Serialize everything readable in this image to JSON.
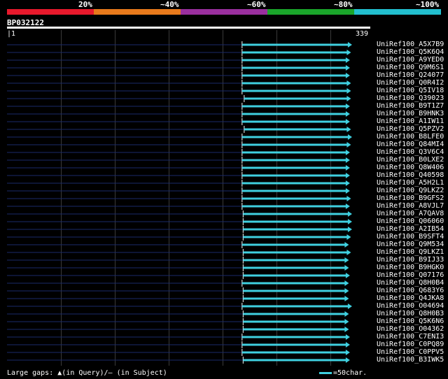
{
  "identity_scale": {
    "labels": [
      "20%",
      "~40%",
      "~60%",
      "~80%",
      "~100%"
    ],
    "colors": [
      "#e8192c",
      "#e87a1c",
      "#9a2f9e",
      "#1aa52a",
      "#22bfcf"
    ]
  },
  "query": {
    "name": "BP032122",
    "start": "1",
    "end": "339"
  },
  "hits": [
    {
      "name": "UniRef100_A5X7B9",
      "start": 224,
      "end": 327
    },
    {
      "name": "UniRef100_Q5K6Q4",
      "start": 224,
      "end": 326
    },
    {
      "name": "UniRef100_A9YED0",
      "start": 224,
      "end": 325
    },
    {
      "name": "UniRef100_Q9M6S1",
      "start": 224,
      "end": 325
    },
    {
      "name": "UniRef100_Q24077",
      "start": 224,
      "end": 325
    },
    {
      "name": "UniRef100_Q0R4I2",
      "start": 224,
      "end": 326
    },
    {
      "name": "UniRef100_Q5IV18",
      "start": 224,
      "end": 326
    },
    {
      "name": "UniRef100_Q39023",
      "start": 226,
      "end": 326
    },
    {
      "name": "UniRef100_B9T1Z7",
      "start": 224,
      "end": 325
    },
    {
      "name": "UniRef100_B9HNK3",
      "start": 224,
      "end": 325
    },
    {
      "name": "UniRef100_A1IW11",
      "start": 224,
      "end": 325
    },
    {
      "name": "UniRef100_Q5PZV2",
      "start": 226,
      "end": 326
    },
    {
      "name": "UniRef100_B8LFE0",
      "start": 224,
      "end": 327
    },
    {
      "name": "UniRef100_Q84MI4",
      "start": 224,
      "end": 326
    },
    {
      "name": "UniRef100_Q3V6C4",
      "start": 224,
      "end": 325
    },
    {
      "name": "UniRef100_B0LXE2",
      "start": 224,
      "end": 325
    },
    {
      "name": "UniRef100_Q8W406",
      "start": 224,
      "end": 325
    },
    {
      "name": "UniRef100_Q40598",
      "start": 224,
      "end": 325
    },
    {
      "name": "UniRef100_A5H2L1",
      "start": 224,
      "end": 325
    },
    {
      "name": "UniRef100_Q9LKZ2",
      "start": 224,
      "end": 325
    },
    {
      "name": "UniRef100_B9GFS2",
      "start": 224,
      "end": 326
    },
    {
      "name": "UniRef100_A8VJL7",
      "start": 224,
      "end": 325
    },
    {
      "name": "UniRef100_A7QAV8",
      "start": 225,
      "end": 327
    },
    {
      "name": "UniRef100_Q06060",
      "start": 225,
      "end": 327
    },
    {
      "name": "UniRef100_A2IB54",
      "start": 225,
      "end": 327
    },
    {
      "name": "UniRef100_B9SFT4",
      "start": 225,
      "end": 326
    },
    {
      "name": "UniRef100_Q9M534",
      "start": 224,
      "end": 324
    },
    {
      "name": "UniRef100_Q9LKZ1",
      "start": 225,
      "end": 326
    },
    {
      "name": "UniRef100_B9IJ33",
      "start": 225,
      "end": 324
    },
    {
      "name": "UniRef100_B9HGK0",
      "start": 225,
      "end": 324
    },
    {
      "name": "UniRef100_Q07176",
      "start": 225,
      "end": 325
    },
    {
      "name": "UniRef100_Q8H0B4",
      "start": 224,
      "end": 324
    },
    {
      "name": "UniRef100_Q683Y6",
      "start": 225,
      "end": 324
    },
    {
      "name": "UniRef100_Q4JKA8",
      "start": 225,
      "end": 324
    },
    {
      "name": "UniRef100_O04694",
      "start": 224,
      "end": 327
    },
    {
      "name": "UniRef100_Q8H0B3",
      "start": 225,
      "end": 324
    },
    {
      "name": "UniRef100_Q5K6N6",
      "start": 225,
      "end": 324
    },
    {
      "name": "UniRef100_O04362",
      "start": 225,
      "end": 324
    },
    {
      "name": "UniRef100_C7ENI3",
      "start": 224,
      "end": 325
    },
    {
      "name": "UniRef100_C0PQ89",
      "start": 224,
      "end": 325
    },
    {
      "name": "UniRef100_C0PPV5",
      "start": 224,
      "end": 325
    },
    {
      "name": "UniRef100_B3IWK5",
      "start": 225,
      "end": 325
    }
  ],
  "legend": {
    "large_gaps": "Large gaps:",
    "query_glyph": "▲",
    "query_text": "(in Query)/",
    "subject_glyph": "—",
    "subject_text": " (in Subject)",
    "scale_text": "=50char."
  },
  "colors": {
    "hit_line": "#3fd0e0",
    "pre_line": "#1a2a6a",
    "grid": "#3a3a3a"
  }
}
